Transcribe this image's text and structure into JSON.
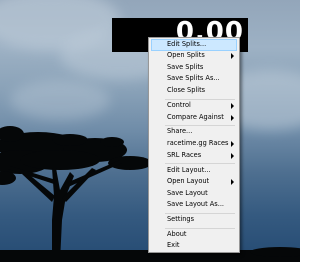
{
  "timer": {
    "display": "0.00"
  },
  "menu": {
    "items": [
      {
        "label": "Edit Splits...",
        "submenu": false,
        "selected": true
      },
      {
        "label": "Open Splits",
        "submenu": true
      },
      {
        "label": "Save Splits",
        "submenu": false
      },
      {
        "label": "Save Splits As...",
        "submenu": false
      },
      {
        "label": "Close Splits",
        "submenu": false
      },
      {
        "label": "Control",
        "submenu": true
      },
      {
        "label": "Compare Against",
        "submenu": true
      },
      {
        "label": "Share...",
        "submenu": false
      },
      {
        "label": "racetime.gg Races",
        "submenu": true
      },
      {
        "label": "SRL Races",
        "submenu": true
      },
      {
        "label": "Edit Layout...",
        "submenu": false
      },
      {
        "label": "Open Layout",
        "submenu": true
      },
      {
        "label": "Save Layout",
        "submenu": false
      },
      {
        "label": "Save Layout As...",
        "submenu": false
      },
      {
        "label": "Settings",
        "submenu": false
      },
      {
        "label": "About",
        "submenu": false
      },
      {
        "label": "Exit",
        "submenu": false
      }
    ]
  },
  "colors": {
    "menu_background": "#f0f0f0",
    "highlight": "#cce8ff",
    "timer_background": "#000000"
  },
  "icons": [
    "submenu-arrow-icon"
  ]
}
